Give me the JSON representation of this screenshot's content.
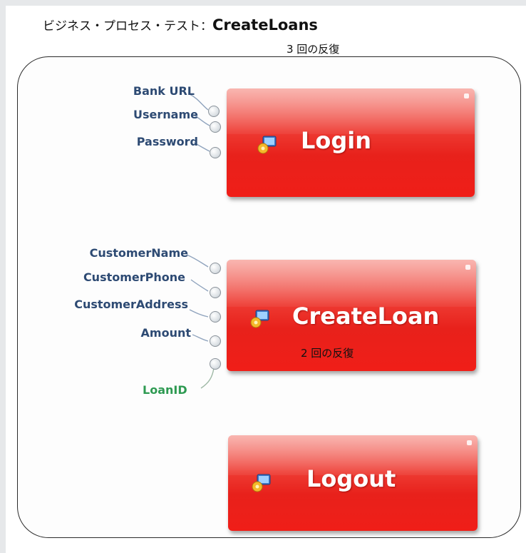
{
  "header": {
    "prefix": "ビジネス・プロセス・テスト：",
    "test_name": "CreateLoans",
    "iterations": "3 回の反復"
  },
  "blocks": {
    "login": {
      "label": "Login",
      "inputs": [
        "Bank URL",
        "Username",
        "Password"
      ]
    },
    "createloan": {
      "label": "CreateLoan",
      "iterations": "2 回の反復",
      "inputs": [
        "CustomerName",
        "CustomerPhone",
        "CustomerAddress",
        "Amount"
      ],
      "output": "LoanID"
    },
    "logout": {
      "label": "Logout"
    }
  },
  "colors": {
    "block_red": "#ee2a22",
    "input_param": "#2d4a73",
    "output_param": "#2e9a52",
    "frame_border": "#2a2a2a"
  },
  "icons": {
    "component": "component-gear-icon",
    "port": "port-circle-icon"
  }
}
